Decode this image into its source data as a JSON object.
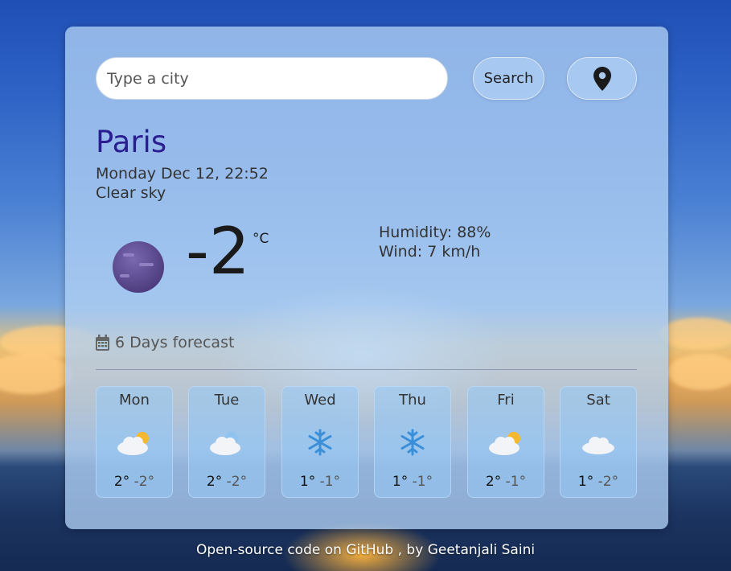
{
  "search": {
    "placeholder": "Type a city",
    "button_label": "Search"
  },
  "icons": {
    "location": "map-pin-icon",
    "forecast": "calendar-icon"
  },
  "current": {
    "city": "Paris",
    "datetime": "Monday Dec 12, 22:52",
    "description": "Clear sky",
    "temperature": "-2",
    "unit": "°C",
    "humidity": "Humidity: 88%",
    "wind": "Wind: 7 km/h",
    "icon": "clear-night-moon-icon"
  },
  "forecast": {
    "title": "6 Days forecast",
    "days": [
      {
        "name": "Mon",
        "max": "2°",
        "min": "-2°",
        "icon": "partly-cloudy-icon"
      },
      {
        "name": "Tue",
        "max": "2°",
        "min": "-2°",
        "icon": "cloudy-icon"
      },
      {
        "name": "Wed",
        "max": "1°",
        "min": "-1°",
        "icon": "snowflake-icon"
      },
      {
        "name": "Thu",
        "max": "1°",
        "min": "-1°",
        "icon": "snowflake-icon"
      },
      {
        "name": "Fri",
        "max": "2°",
        "min": "-1°",
        "icon": "partly-cloudy-icon"
      },
      {
        "name": "Sat",
        "max": "1°",
        "min": "-2°",
        "icon": "cloud-icon"
      }
    ]
  },
  "footer": {
    "text": "Open-source code on GitHub , by Geetanjali Saini"
  },
  "colors": {
    "city": "#2a1d8f",
    "card": "#b0d0f4",
    "moon": "#5b4a8f"
  }
}
